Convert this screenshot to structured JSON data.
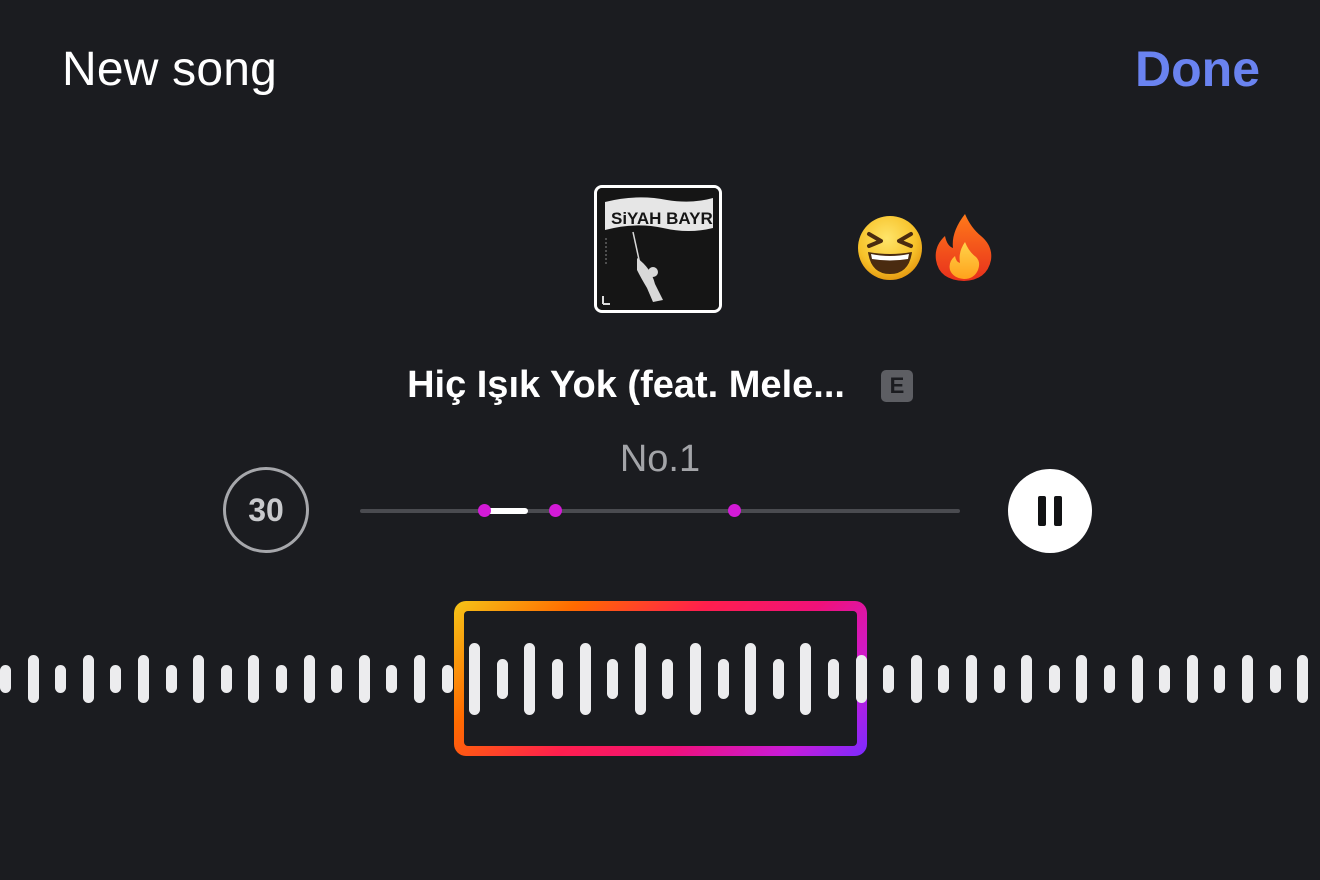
{
  "header": {
    "title": "New song",
    "done_label": "Done"
  },
  "colors": {
    "background": "#1b1c20",
    "accent": "#6a83f0",
    "marker": "#d21ad6",
    "gradient": [
      "#f5c518",
      "#ff6a00",
      "#ff1f4d",
      "#f0117a",
      "#c81bd8",
      "#7a2bff"
    ]
  },
  "album": {
    "art_text": "SiYAH BAYRAK"
  },
  "reactions": [
    "grinning-squinting-face-emoji",
    "fire-emoji"
  ],
  "song": {
    "title": "Hiç Işık Yok (feat. Mele...",
    "explicit_badge": "E",
    "artist": "No.1"
  },
  "controls": {
    "duration_label": "30",
    "play_state_icon": "pause-icon"
  },
  "scrubber": {
    "selection_start_fraction": 0.21,
    "selection_end_fraction": 0.28,
    "marker_fractions": [
      0.207,
      0.325,
      0.623
    ]
  }
}
